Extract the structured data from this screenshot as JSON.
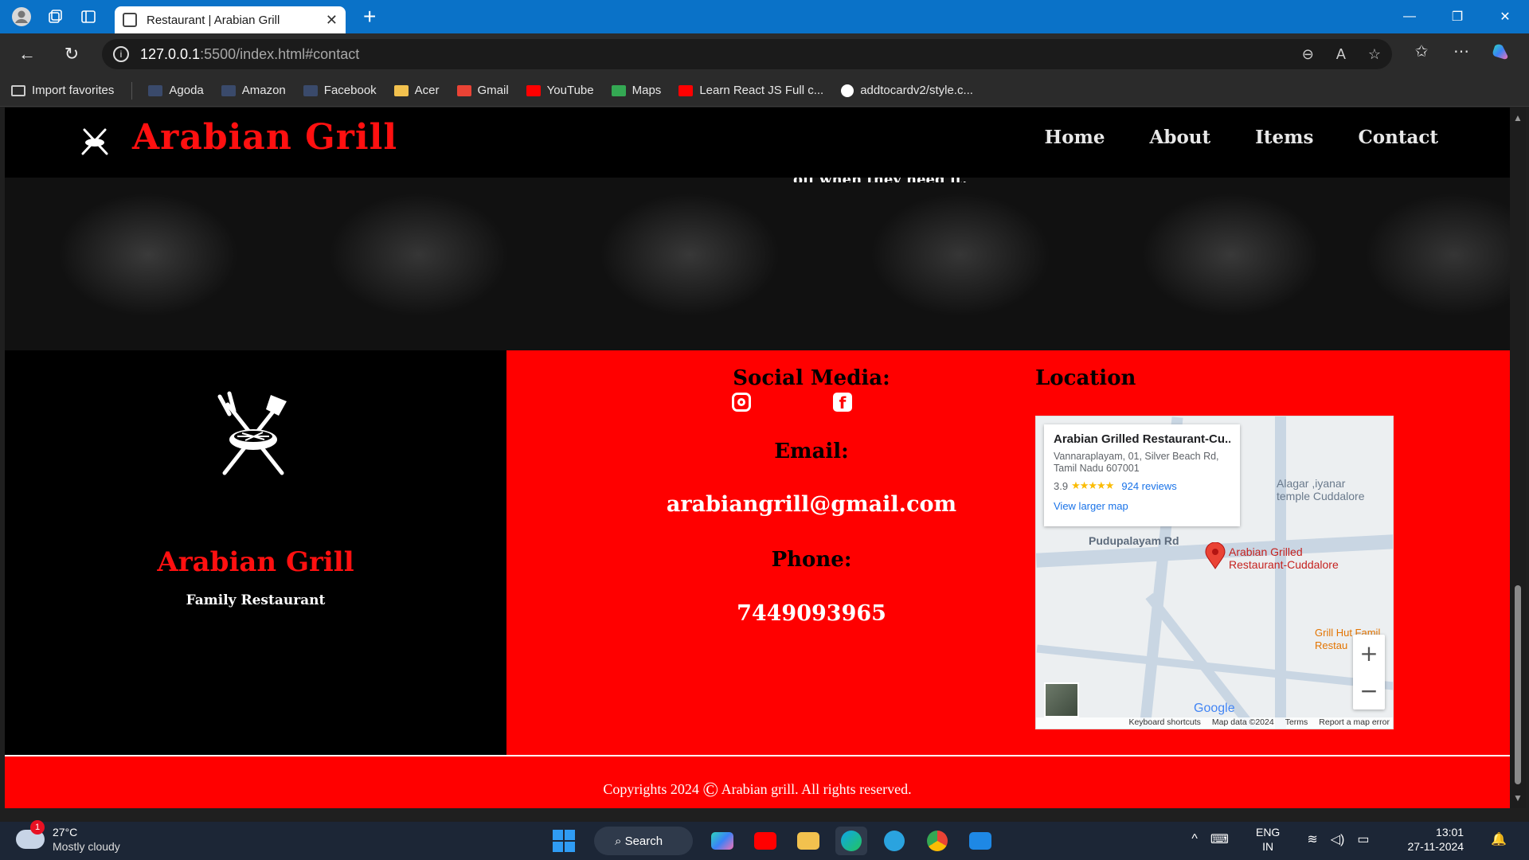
{
  "browser": {
    "tab_title": "Restaurant | Arabian Grill",
    "url_host": "127.0.0.1",
    "url_path": ":5500/index.html#contact",
    "favorites": [
      {
        "label": "Import favorites",
        "color": "#cccccc"
      },
      {
        "label": "Agoda",
        "color": "#3a4a6b"
      },
      {
        "label": "Amazon",
        "color": "#3a4a6b"
      },
      {
        "label": "Facebook",
        "color": "#3a4a6b"
      },
      {
        "label": "Acer",
        "color": "#f2c14e"
      },
      {
        "label": "Gmail",
        "color": "#ea4335"
      },
      {
        "label": "YouTube",
        "color": "#ff0000"
      },
      {
        "label": "Maps",
        "color": "#34a853"
      },
      {
        "label": "Learn React JS Full c...",
        "color": "#ff0000"
      },
      {
        "label": "addtocardv2/style.c...",
        "color": "#ffffff"
      }
    ]
  },
  "site": {
    "brand": "Arabian Grill",
    "nav": [
      "Home",
      "About",
      "Items",
      "Contact"
    ],
    "cut_text": "off when they need it,",
    "left": {
      "title": "Arabian Grill",
      "subtitle": "Family Restaurant"
    },
    "contact": {
      "social_heading": "Social Media:",
      "email_heading": "Email:",
      "email": "arabiangrill@gmail.com",
      "phone_heading": "Phone:",
      "phone": "7449093965",
      "location_heading": "Location"
    },
    "map": {
      "name": "Arabian Grilled Restaurant-Cu...",
      "address_line1": "Vannaraplayam, 01, Silver Beach Rd,",
      "address_line2": "Tamil Nadu 607001",
      "rating": "3.9",
      "stars": "★★★★★",
      "reviews": "924 reviews",
      "view_larger": "View larger map",
      "road1": "Pudupalayam Rd",
      "pin_label_1": "Arabian Grilled",
      "pin_label_2": "Restaurant-Cuddalore",
      "temple_1": "Alagar ,iyanar",
      "temple_2": "temple Cuddalore",
      "poi_1": "Grill Hut Famil",
      "poi_2": "Restau",
      "google": "Google",
      "footer": [
        "Keyboard shortcuts",
        "Map data ©2024",
        "Terms",
        "Report a map error"
      ],
      "zoom_in": "+",
      "zoom_out": "−"
    },
    "footer": {
      "prefix": "Copyrights 2024 ",
      "symbol": "©",
      "suffix": " Arabian grill. All rights reserved."
    }
  },
  "taskbar": {
    "weather_temp": "27°C",
    "weather_desc": "Mostly cloudy",
    "badge": "1",
    "search": "Search",
    "lang1": "ENG",
    "lang2": "IN",
    "time": "13:01",
    "date": "27-11-2024"
  }
}
